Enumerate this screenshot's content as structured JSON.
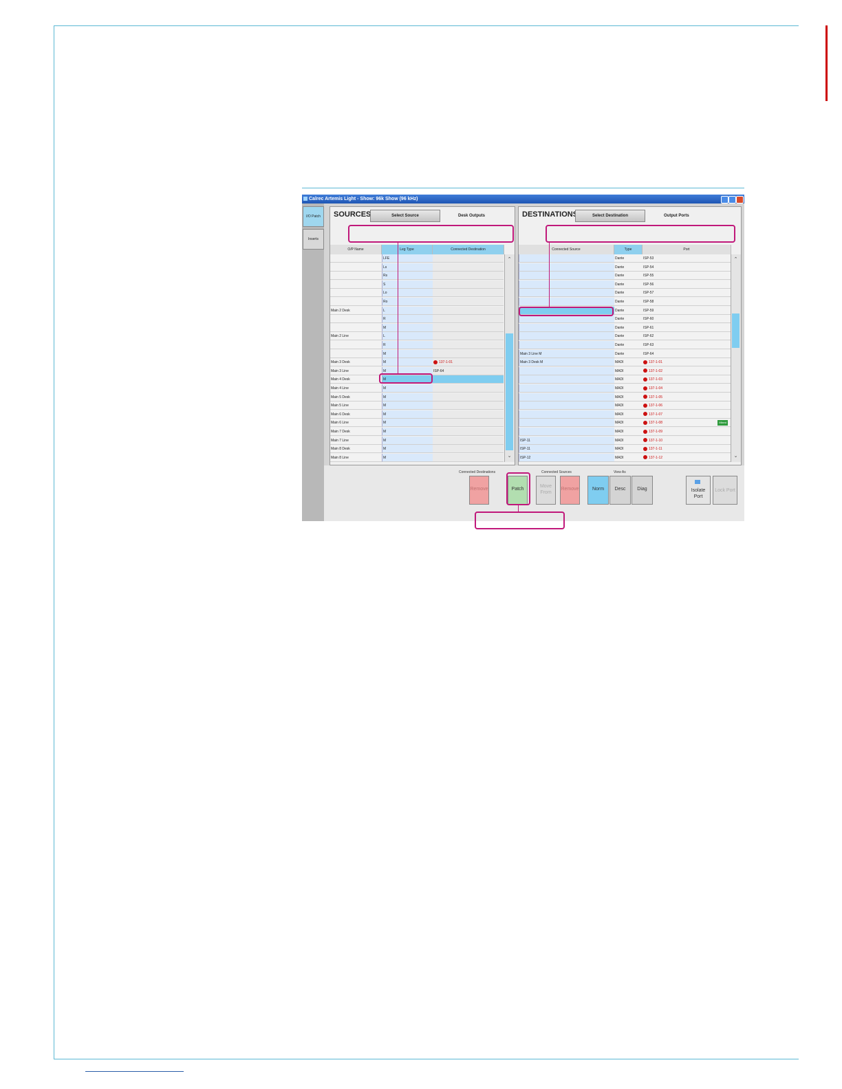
{
  "window": {
    "title": "Calrec Artemis Light - Show: 96k Show (96 kHz)"
  },
  "sidebar": {
    "items": [
      {
        "label": "I/O Patch",
        "active": true
      },
      {
        "label": "Inserts",
        "active": false
      }
    ]
  },
  "sources": {
    "title": "SOURCES",
    "select_button": "Select Source",
    "subtitle": "Desk Outputs",
    "columns": [
      "O/P Name",
      "Leg Type",
      "Connected Destination"
    ],
    "rows": [
      {
        "name": "",
        "leg": "LFE",
        "dest": ""
      },
      {
        "name": "",
        "leg": "Ls",
        "dest": ""
      },
      {
        "name": "",
        "leg": "Rs",
        "dest": ""
      },
      {
        "name": "",
        "leg": "S",
        "dest": ""
      },
      {
        "name": "",
        "leg": "Lo",
        "dest": ""
      },
      {
        "name": "",
        "leg": "Ro",
        "dest": ""
      },
      {
        "name": "Main 2 Desk",
        "leg": "L",
        "dest": ""
      },
      {
        "name": "",
        "leg": "R",
        "dest": ""
      },
      {
        "name": "",
        "leg": "M",
        "dest": ""
      },
      {
        "name": "Main 2 Line",
        "leg": "L",
        "dest": ""
      },
      {
        "name": "",
        "leg": "R",
        "dest": ""
      },
      {
        "name": "",
        "leg": "M",
        "dest": ""
      },
      {
        "name": "Main 3 Desk",
        "leg": "M",
        "dest": "137-1-01",
        "dest_warn": true
      },
      {
        "name": "Main 3 Line",
        "leg": "M",
        "dest": "ISP-64"
      },
      {
        "name": "Main 4 Desk",
        "leg": "M",
        "dest": "",
        "selected": true
      },
      {
        "name": "Main 4 Line",
        "leg": "M",
        "dest": ""
      },
      {
        "name": "Main 5 Desk",
        "leg": "M",
        "dest": ""
      },
      {
        "name": "Main 5 Line",
        "leg": "M",
        "dest": ""
      },
      {
        "name": "Main 6 Desk",
        "leg": "M",
        "dest": ""
      },
      {
        "name": "Main 6 Line",
        "leg": "M",
        "dest": ""
      },
      {
        "name": "Main 7 Desk",
        "leg": "M",
        "dest": ""
      },
      {
        "name": "Main 7 Line",
        "leg": "M",
        "dest": ""
      },
      {
        "name": "Main 8 Desk",
        "leg": "M",
        "dest": ""
      },
      {
        "name": "Main 8 Line",
        "leg": "M",
        "dest": ""
      }
    ]
  },
  "destinations": {
    "title": "DESTINATIONS",
    "select_button": "Select Destination",
    "subtitle": "Output Ports",
    "columns": [
      "Connected Source",
      "Type",
      "Port"
    ],
    "rows": [
      {
        "src": "",
        "type": "Dante",
        "port": "ISP-53"
      },
      {
        "src": "",
        "type": "Dante",
        "port": "ISP-54"
      },
      {
        "src": "",
        "type": "Dante",
        "port": "ISP-55"
      },
      {
        "src": "",
        "type": "Dante",
        "port": "ISP-56"
      },
      {
        "src": "",
        "type": "Dante",
        "port": "ISP-57"
      },
      {
        "src": "",
        "type": "Dante",
        "port": "ISP-58"
      },
      {
        "src": "",
        "type": "Dante",
        "port": "ISP-59",
        "selected": true
      },
      {
        "src": "",
        "type": "Dante",
        "port": "ISP-60"
      },
      {
        "src": "",
        "type": "Dante",
        "port": "ISP-61"
      },
      {
        "src": "",
        "type": "Dante",
        "port": "ISP-62"
      },
      {
        "src": "",
        "type": "Dante",
        "port": "ISP-63"
      },
      {
        "src": "Main 3 Line M",
        "type": "Dante",
        "port": "ISP-64"
      },
      {
        "src": "Main 3 Desk M",
        "type": "MADI",
        "port": "137-1-01",
        "warn": true
      },
      {
        "src": "",
        "type": "MADI",
        "port": "137-1-02",
        "warn": true
      },
      {
        "src": "",
        "type": "MADI",
        "port": "137-1-03",
        "warn": true
      },
      {
        "src": "",
        "type": "MADI",
        "port": "137-1-04",
        "warn": true
      },
      {
        "src": "",
        "type": "MADI",
        "port": "137-1-05",
        "warn": true
      },
      {
        "src": "",
        "type": "MADI",
        "port": "137-1-06",
        "warn": true
      },
      {
        "src": "",
        "type": "MADI",
        "port": "137-1-07",
        "warn": true
      },
      {
        "src": "",
        "type": "MADI",
        "port": "137-1-08",
        "warn": true,
        "badge": "Mixed"
      },
      {
        "src": "",
        "type": "MADI",
        "port": "137-1-09",
        "warn": true
      },
      {
        "src": "ISP-11",
        "type": "MADI",
        "port": "137-1-10",
        "warn": true
      },
      {
        "src": "ISP-11",
        "type": "MADI",
        "port": "137-1-11",
        "warn": true
      },
      {
        "src": "ISP-12",
        "type": "MADI",
        "port": "137-1-12",
        "warn": true
      }
    ]
  },
  "bottom": {
    "connected_destinations_label": "Connected Destinations",
    "connected_sources_label": "Connected Sources",
    "view_as_label": "View As",
    "remove_dest_label": "Remove",
    "patch_label": "Patch",
    "move_from_label": "Move From",
    "remove_src_label": "Remove",
    "norm_label": "Norm",
    "desc_label": "Desc",
    "diag_label": "Diag",
    "isolate_port_label": "Isolate Port",
    "lock_port_label": "Lock Port"
  },
  "colors": {
    "accent_blue": "#7fcdf0",
    "callout_magenta": "#c0187a",
    "warning_red": "#cc1111",
    "patch_green": "#b2deb0",
    "remove_red": "#f0a2a2"
  }
}
